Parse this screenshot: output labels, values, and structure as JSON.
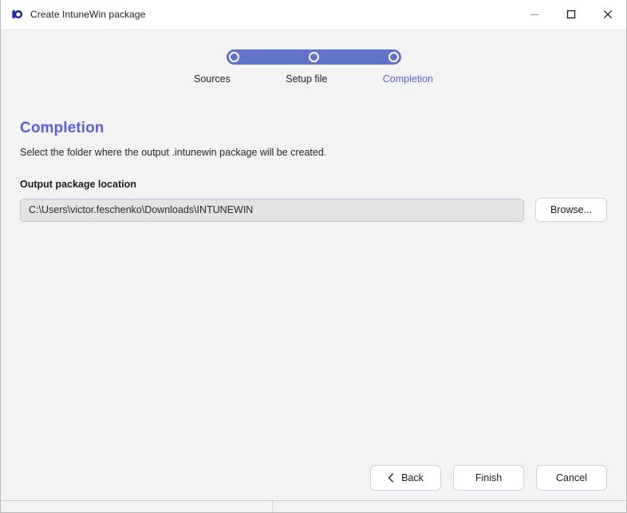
{
  "window": {
    "title": "Create IntuneWin package",
    "app_icon": "intune-app-icon",
    "controls": {
      "minimize": "minimize-icon",
      "maximize": "maximize-icon",
      "close": "close-icon"
    }
  },
  "stepper": {
    "steps": [
      {
        "label": "Sources",
        "state": "complete",
        "dot": "step-dot-icon"
      },
      {
        "label": "Setup file",
        "state": "complete",
        "dot": "step-dot-icon"
      },
      {
        "label": "Completion",
        "state": "active",
        "dot": "step-dot-icon"
      }
    ],
    "track_color": "#6272c8",
    "active_label_color": "#5b61d6"
  },
  "content": {
    "heading": "Completion",
    "description": "Select the folder where the output .intunewin package will be created.",
    "field": {
      "label": "Output package location",
      "value": "C:\\Users\\victor.feschenko\\Downloads\\INTUNEWIN",
      "placeholder": "",
      "browse_label": "Browse..."
    }
  },
  "footer": {
    "back_label": "Back",
    "back_icon": "chevron-left-icon",
    "finish_label": "Finish",
    "cancel_label": "Cancel"
  },
  "colors": {
    "accent": "#5b61d6",
    "track": "#6272c8",
    "window_background": "#f3f3f3",
    "titlebar_background": "#ffffff",
    "input_background": "#e3e3e3"
  }
}
